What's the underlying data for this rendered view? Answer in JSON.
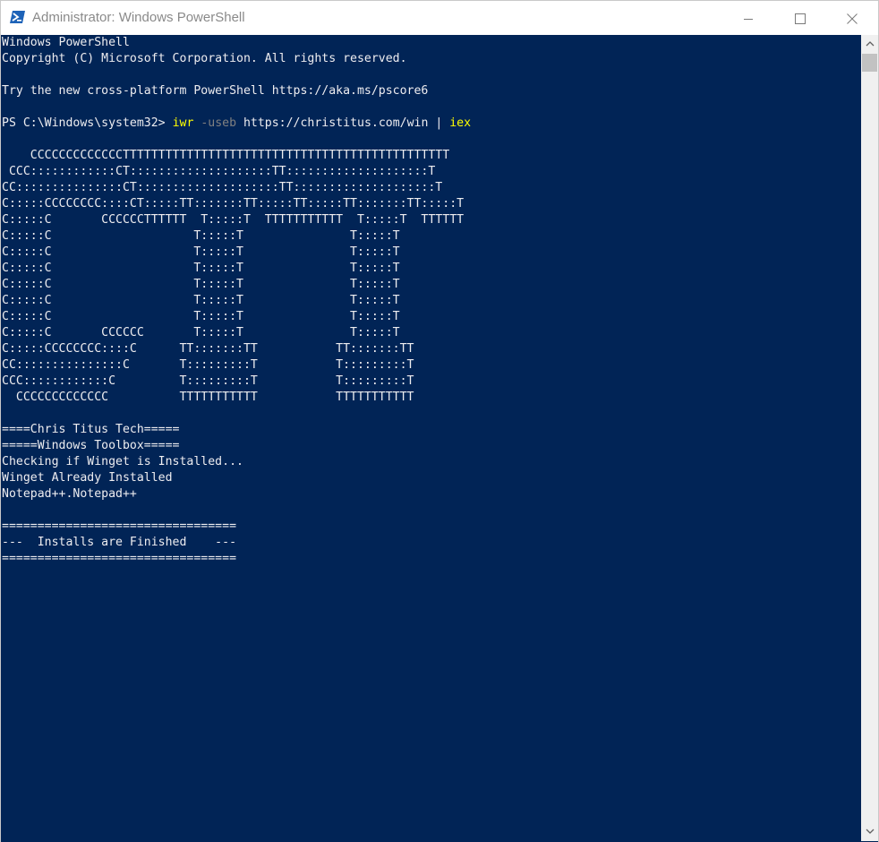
{
  "window": {
    "title": "Administrator: Windows PowerShell",
    "background": "#012456",
    "text_color": "#eeedf0",
    "command_color": "#ffff00",
    "parameter_color": "#808080",
    "icons": {
      "app": "powershell-icon",
      "minimize": "minimize-icon",
      "maximize": "maximize-icon",
      "close": "close-icon",
      "scroll_up": "chevron-up-icon",
      "scroll_down": "chevron-down-icon"
    }
  },
  "console": {
    "header": [
      "Windows PowerShell",
      "Copyright (C) Microsoft Corporation. All rights reserved.",
      "",
      "Try the new cross-platform PowerShell https://aka.ms/pscore6"
    ],
    "prompt": {
      "path": "PS C:\\Windows\\system32> ",
      "cmd1": "iwr",
      "param": " -useb",
      "url": " https://christitus.com/win | ",
      "cmd2": "iex"
    },
    "banner": [
      "    CCCCCCCCCCCCCTTTTTTTTTTTTTTTTTTTTTTTTTTTTTTTTTTTTTTTTTTTTTT",
      " CCC::::::::::::CT::::::::::::::::::::TT::::::::::::::::::::T",
      "CC:::::::::::::::CT::::::::::::::::::::TT::::::::::::::::::::T",
      "C:::::CCCCCCCC::::CT:::::TT:::::::TT:::::TT:::::TT:::::::TT:::::T",
      "C:::::C       CCCCCCTTTTTT  T:::::T  TTTTTTTTTTT  T:::::T  TTTTTT",
      "C:::::C                    T:::::T               T:::::T",
      "C:::::C                    T:::::T               T:::::T",
      "C:::::C                    T:::::T               T:::::T",
      "C:::::C                    T:::::T               T:::::T",
      "C:::::C                    T:::::T               T:::::T",
      "C:::::C                    T:::::T               T:::::T",
      "C:::::C       CCCCCC       T:::::T               T:::::T",
      "C:::::CCCCCCCC::::C      TT:::::::TT           TT:::::::TT",
      "CC:::::::::::::::C       T:::::::::T           T:::::::::T",
      "CCC::::::::::::C         T:::::::::T           T:::::::::T",
      "  CCCCCCCCCCCCC          TTTTTTTTTTT           TTTTTTTTTTT"
    ],
    "output": [
      "====Chris Titus Tech=====",
      "=====Windows Toolbox=====",
      "Checking if Winget is Installed...",
      "Winget Already Installed",
      "Notepad++.Notepad++",
      "",
      "=================================",
      "---  Installs are Finished    ---",
      "================================="
    ]
  }
}
